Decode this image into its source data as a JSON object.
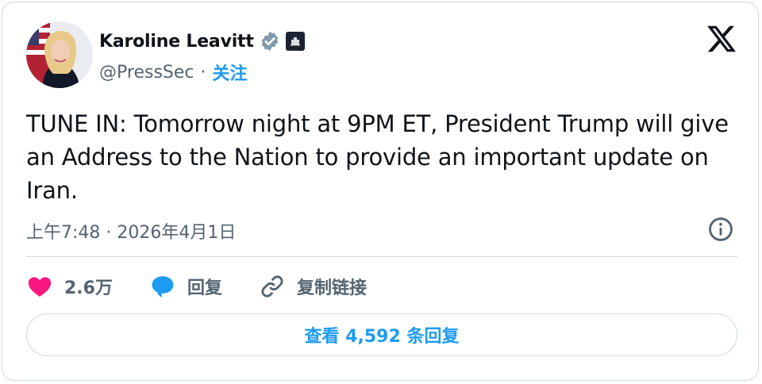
{
  "author": {
    "name": "Karoline Leavitt",
    "handle": "@PressSec",
    "separator": "·",
    "follow_label": "关注"
  },
  "icons": {
    "verified": "verified-badge-icon",
    "affiliation": "white-house-badge-icon",
    "brand": "x-logo-icon",
    "info": "info-icon",
    "like": "heart-icon",
    "reply": "speech-bubble-icon",
    "link": "link-icon"
  },
  "tweet": {
    "text": "TUNE IN: Tomorrow night at 9PM ET, President Trump will give an Address to the Nation to provide an important update on Iran.",
    "timestamp": "上午7:48 · 2026年4月1日"
  },
  "actions": {
    "like_count": "2.6万",
    "reply_label": "回复",
    "copy_link_label": "复制链接"
  },
  "replies_button": {
    "label": "查看 4,592 条回复"
  },
  "colors": {
    "accent": "#1d9bf0",
    "like": "#f91880",
    "muted": "#536471",
    "text": "#0f1419",
    "border": "#cfd9de"
  }
}
